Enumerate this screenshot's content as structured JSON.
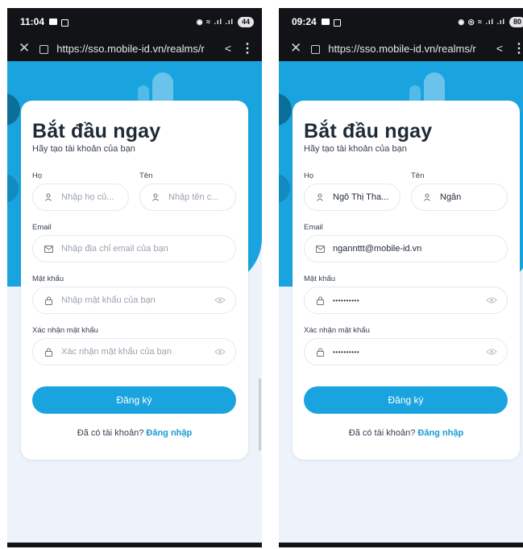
{
  "phones": [
    {
      "status": {
        "time": "11:04",
        "battery": "44",
        "signal": "◉ ≈ .ıl .ıl"
      },
      "browser": {
        "url": "https://sso.mobile-id.vn/realms/r"
      },
      "form": {
        "title": "Bắt đầu ngay",
        "subtitle": "Hãy tạo tài khoản của bạn",
        "last_name": {
          "label": "Họ",
          "value": "Nhập họ củ...",
          "is_placeholder": true
        },
        "first_name": {
          "label": "Tên",
          "value": "Nhập tên c...",
          "is_placeholder": true
        },
        "email": {
          "label": "Email",
          "value": "Nhập địa chỉ email của bạn",
          "is_placeholder": true
        },
        "password": {
          "label": "Mật khẩu",
          "value": "Nhập mật khẩu của bạn",
          "is_placeholder": true
        },
        "confirm": {
          "label": "Xác nhận mật khẩu",
          "value": "Xác nhận mật khẩu của bạn",
          "is_placeholder": true
        },
        "submit_label": "Đăng ký",
        "have_account_text": "Đã có tài khoản?",
        "login_link": "Đăng nhập"
      }
    },
    {
      "status": {
        "time": "09:24",
        "battery": "80",
        "signal": "◉ ◎ ≈ .ıl .ıl"
      },
      "browser": {
        "url": "https://sso.mobile-id.vn/realms/r"
      },
      "form": {
        "title": "Bắt đầu ngay",
        "subtitle": "Hãy tạo tài khoản của bạn",
        "last_name": {
          "label": "Họ",
          "value": "Ngô Thị Tha...",
          "is_placeholder": false
        },
        "first_name": {
          "label": "Tên",
          "value": "Ngân",
          "is_placeholder": false
        },
        "email": {
          "label": "Email",
          "value": "ngannttt@mobile-id.vn",
          "is_placeholder": false
        },
        "password": {
          "label": "Mật khẩu",
          "value": "••••••••••",
          "is_placeholder": false
        },
        "confirm": {
          "label": "Xác nhận mật khẩu",
          "value": "••••••••••",
          "is_placeholder": false
        },
        "submit_label": "Đăng ký",
        "have_account_text": "Đã có tài khoản?",
        "login_link": "Đăng nhập"
      }
    }
  ],
  "icons": {
    "close": "close-icon",
    "lock": "lock-icon",
    "share": "share-icon",
    "menu": "more-vert-icon",
    "person": "person-icon",
    "mail": "mail-icon",
    "eye": "eye-icon"
  },
  "colors": {
    "accent": "#1aa4df",
    "link": "#1a9ad4",
    "background": "#eef3fb"
  }
}
